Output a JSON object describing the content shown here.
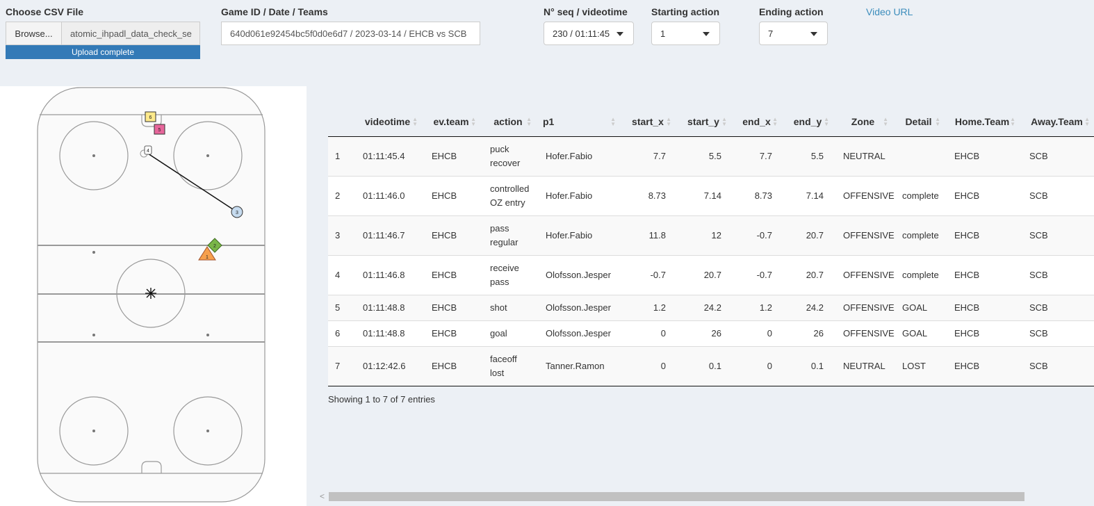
{
  "controls": {
    "csv_label": "Choose CSV File",
    "browse_label": "Browse...",
    "file_name": "atomic_ihpadl_data_check_se",
    "upload_status": "Upload complete",
    "upload_progress": 1.0,
    "game_label": "Game ID / Date / Teams",
    "game_value": "640d061e92454bc5f0d0e6d7 / 2023-03-14 / EHCB vs SCB",
    "seq_label": "N° seq / videotime",
    "seq_value": "230 / 01:11:45",
    "start_label": "Starting action",
    "start_value": "1",
    "end_label": "Ending action",
    "end_value": "7",
    "video_link": "Video URL"
  },
  "rink": {
    "markers": [
      {
        "label": "1",
        "shape": "triangle",
        "color": "#f6a04d"
      },
      {
        "label": "2",
        "shape": "diamond",
        "color": "#7ab648"
      },
      {
        "label": "3",
        "shape": "circle",
        "color": "#c6dbef"
      },
      {
        "label": "4",
        "shape": "square-small",
        "color": "#ffffff"
      },
      {
        "label": "5",
        "shape": "square",
        "color": "#e7669b"
      },
      {
        "label": "6",
        "shape": "square",
        "color": "#fde98b"
      }
    ]
  },
  "table": {
    "headers": [
      "",
      "videotime",
      "ev.team",
      "action",
      "p1",
      "start_x",
      "start_y",
      "end_x",
      "end_y",
      "Zone",
      "Detail",
      "Home.Team",
      "Away.Team"
    ],
    "rows": [
      [
        "1",
        "01:11:45.4",
        "EHCB",
        "puck recover",
        "Hofer.Fabio",
        "7.7",
        "5.5",
        "7.7",
        "5.5",
        "NEUTRAL",
        "",
        "EHCB",
        "SCB"
      ],
      [
        "2",
        "01:11:46.0",
        "EHCB",
        "controlled OZ entry",
        "Hofer.Fabio",
        "8.73",
        "7.14",
        "8.73",
        "7.14",
        "OFFENSIVE",
        "complete",
        "EHCB",
        "SCB"
      ],
      [
        "3",
        "01:11:46.7",
        "EHCB",
        "pass regular",
        "Hofer.Fabio",
        "11.8",
        "12",
        "-0.7",
        "20.7",
        "OFFENSIVE",
        "complete",
        "EHCB",
        "SCB"
      ],
      [
        "4",
        "01:11:46.8",
        "EHCB",
        "receive pass",
        "Olofsson.Jesper",
        "-0.7",
        "20.7",
        "-0.7",
        "20.7",
        "OFFENSIVE",
        "complete",
        "EHCB",
        "SCB"
      ],
      [
        "5",
        "01:11:48.8",
        "EHCB",
        "shot",
        "Olofsson.Jesper",
        "1.2",
        "24.2",
        "1.2",
        "24.2",
        "OFFENSIVE",
        "GOAL",
        "EHCB",
        "SCB"
      ],
      [
        "6",
        "01:11:48.8",
        "EHCB",
        "goal",
        "Olofsson.Jesper",
        "0",
        "26",
        "0",
        "26",
        "OFFENSIVE",
        "GOAL",
        "EHCB",
        "SCB"
      ],
      [
        "7",
        "01:12:42.6",
        "EHCB",
        "faceoff lost",
        "Tanner.Ramon",
        "0",
        "0.1",
        "0",
        "0.1",
        "NEUTRAL",
        "LOST",
        "EHCB",
        "SCB"
      ]
    ],
    "info": "Showing 1 to 7 of 7 entries"
  }
}
